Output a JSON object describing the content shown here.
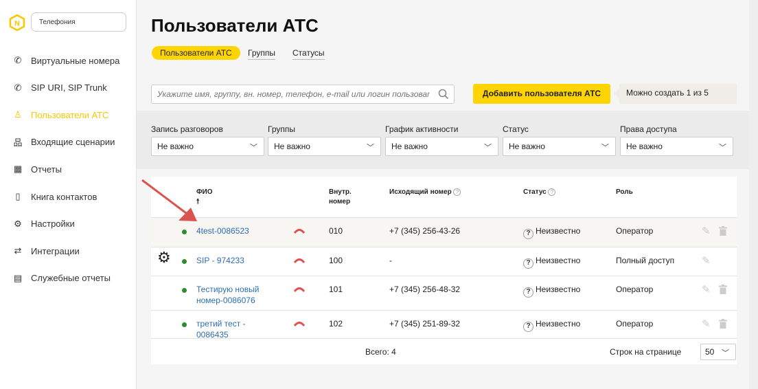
{
  "sidebar": {
    "product": "Телефония",
    "items": [
      {
        "label": "Виртуальные номера",
        "icon": "phone-calls-icon"
      },
      {
        "label": "SIP URI, SIP Trunk",
        "icon": "phone-calls-icon"
      },
      {
        "label": "Пользователи АТС",
        "icon": "user-icon",
        "active": true
      },
      {
        "label": "Входящие сценарии",
        "icon": "hierarchy-icon"
      },
      {
        "label": "Отчеты",
        "icon": "chart-icon"
      },
      {
        "label": "Книга контактов",
        "icon": "contact-book-icon"
      },
      {
        "label": "Настройки",
        "icon": "gear-icon"
      },
      {
        "label": "Интеграции",
        "icon": "integration-icon"
      },
      {
        "label": "Служебные отчеты",
        "icon": "document-icon"
      }
    ]
  },
  "page": {
    "title": "Пользователи АТС",
    "tabs": [
      "Пользователи АТС",
      "Группы",
      "Статусы"
    ],
    "search_placeholder": "Укажите имя, группу, вн. номер, телефон, e-mail или логин пользователя",
    "add_button": "Добавить пользователя АТС",
    "limit_hint": "Можно создать 1 из 5"
  },
  "filters": [
    {
      "label": "Запись разговоров",
      "value": "Не важно"
    },
    {
      "label": "Группы",
      "value": "Не важно"
    },
    {
      "label": "График активности",
      "value": "Не важно"
    },
    {
      "label": "Статус",
      "value": "Не важно"
    },
    {
      "label": "Права доступа",
      "value": "Не важно"
    }
  ],
  "table": {
    "headers": {
      "name": "ФИО",
      "sort": "🠕",
      "ext_1": "Внутр.",
      "ext_2": "номер",
      "outgoing": "Исходящий номер",
      "status": "Статус",
      "role": "Роль"
    },
    "rows": [
      {
        "name": "4test-0086523",
        "ext": "010",
        "outgoing": "+7 (345) 256-43-26",
        "status": "Неизвестно",
        "role": "Оператор",
        "deletable": true
      },
      {
        "name": "SIP - 974233",
        "ext": "100",
        "outgoing": "-",
        "status": "Неизвестно",
        "role": "Полный доступ",
        "deletable": false,
        "admin": true
      },
      {
        "name": "Тестирую новый номер-0086076",
        "ext": "101",
        "outgoing": "+7 (345) 256-48-32",
        "status": "Неизвестно",
        "role": "Оператор",
        "deletable": true
      },
      {
        "name": "третий тест - 0086435",
        "ext": "102",
        "outgoing": "+7 (345) 251-89-32",
        "status": "Неизвестно",
        "role": "Оператор",
        "deletable": true
      }
    ],
    "total": "Всего: 4",
    "per_page_label": "Строк на странице",
    "per_page": "50"
  },
  "colors": {
    "accent": "#ffd400",
    "link": "#2f6db5",
    "online": "#2e8b2e",
    "hangup": "#e05050",
    "annotation_arrow": "#d9534f"
  }
}
